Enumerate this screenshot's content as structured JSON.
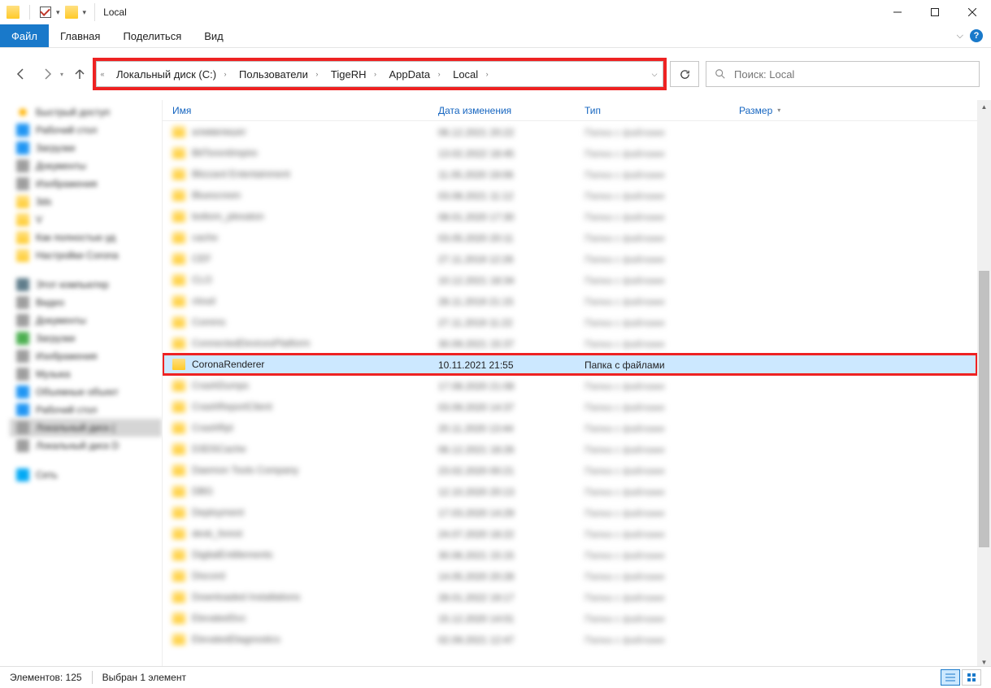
{
  "window": {
    "title": "Local"
  },
  "ribbon": {
    "file": "Файл",
    "tabs": [
      "Главная",
      "Поделиться",
      "Вид"
    ]
  },
  "breadcrumbs": [
    "Локальный диск (C:)",
    "Пользователи",
    "TigeRH",
    "AppData",
    "Local"
  ],
  "search": {
    "placeholder": "Поиск: Local"
  },
  "columns": {
    "name": "Имя",
    "date": "Дата изменения",
    "type": "Тип",
    "size": "Размер"
  },
  "rows": [
    {
      "name": "аливвлишег",
      "date": "06.12.2021 20:22",
      "type": "Папка с файлами",
      "blur": true
    },
    {
      "name": "BitTorentImpire",
      "date": "13.02.2022 18:45",
      "type": "Папка с файлами",
      "blur": true
    },
    {
      "name": "Blizzard Entertainment",
      "date": "11.05.2020 19:06",
      "type": "Папка с файлами",
      "blur": true
    },
    {
      "name": "Bluescreen",
      "date": "03.08.2021 11:12",
      "type": "Папка с файлами",
      "blur": true
    },
    {
      "name": "bottom_plexaton",
      "date": "08.01.2020 17:30",
      "type": "Папка с файлами",
      "blur": true
    },
    {
      "name": "cache",
      "date": "03.05.2020 20:11",
      "type": "Папка с файлами",
      "blur": true
    },
    {
      "name": "CEF",
      "date": "27.11.2019 12:26",
      "type": "Папка с файлами",
      "blur": true
    },
    {
      "name": "CLO",
      "date": "10.12.2021 18:34",
      "type": "Папка с файлами",
      "blur": true
    },
    {
      "name": "cloud",
      "date": "28.11.2019 21:15",
      "type": "Папка с файлами",
      "blur": true
    },
    {
      "name": "Comms",
      "date": "27.11.2019 11:22",
      "type": "Папка с файлами",
      "blur": true
    },
    {
      "name": "ConnectedDevicesPlatform",
      "date": "30.09.2021 15:37",
      "type": "Папка с файлами",
      "blur": true
    },
    {
      "name": "CoronaRenderer",
      "date": "10.11.2021 21:55",
      "type": "Папка с файлами",
      "blur": false,
      "selected": true
    },
    {
      "name": "CrashDumps",
      "date": "17.08.2020 21:08",
      "type": "Папка с файлами",
      "blur": true
    },
    {
      "name": "CrashReportClient",
      "date": "03.09.2020 14:37",
      "type": "Папка с файлами",
      "blur": true
    },
    {
      "name": "CrashRpt",
      "date": "20.11.2020 13:44",
      "type": "Папка с файлами",
      "blur": true
    },
    {
      "name": "D3DSCache",
      "date": "06.12.2021 18:26",
      "type": "Папка с файлами",
      "blur": true
    },
    {
      "name": "Daemon Tools Company",
      "date": "23.02.2020 00:21",
      "type": "Папка с файлами",
      "blur": true
    },
    {
      "name": "DBG",
      "date": "12.10.2020 20:13",
      "type": "Папка с файлами",
      "blur": true
    },
    {
      "name": "Deployment",
      "date": "17.03.2020 14:29",
      "type": "Папка с файлами",
      "blur": true
    },
    {
      "name": "desk_forest",
      "date": "24.07.2020 18:22",
      "type": "Папка с файлами",
      "blur": true
    },
    {
      "name": "DigitalEntitlements",
      "date": "30.06.2021 15:15",
      "type": "Папка с файлами",
      "blur": true
    },
    {
      "name": "Discord",
      "date": "14.05.2020 20:28",
      "type": "Папка с файлами",
      "blur": true
    },
    {
      "name": "Downloaded Installations",
      "date": "28.01.2022 19:17",
      "type": "Папка с файлами",
      "blur": true
    },
    {
      "name": "ElevatedSvc",
      "date": "15.12.2020 14:01",
      "type": "Папка с файлами",
      "blur": true
    },
    {
      "name": "ElevatedDiagnostics",
      "date": "02.09.2021 12:47",
      "type": "Папка с файлами",
      "blur": true
    }
  ],
  "status": {
    "items": "Элементов: 125",
    "selected": "Выбран 1 элемент"
  }
}
